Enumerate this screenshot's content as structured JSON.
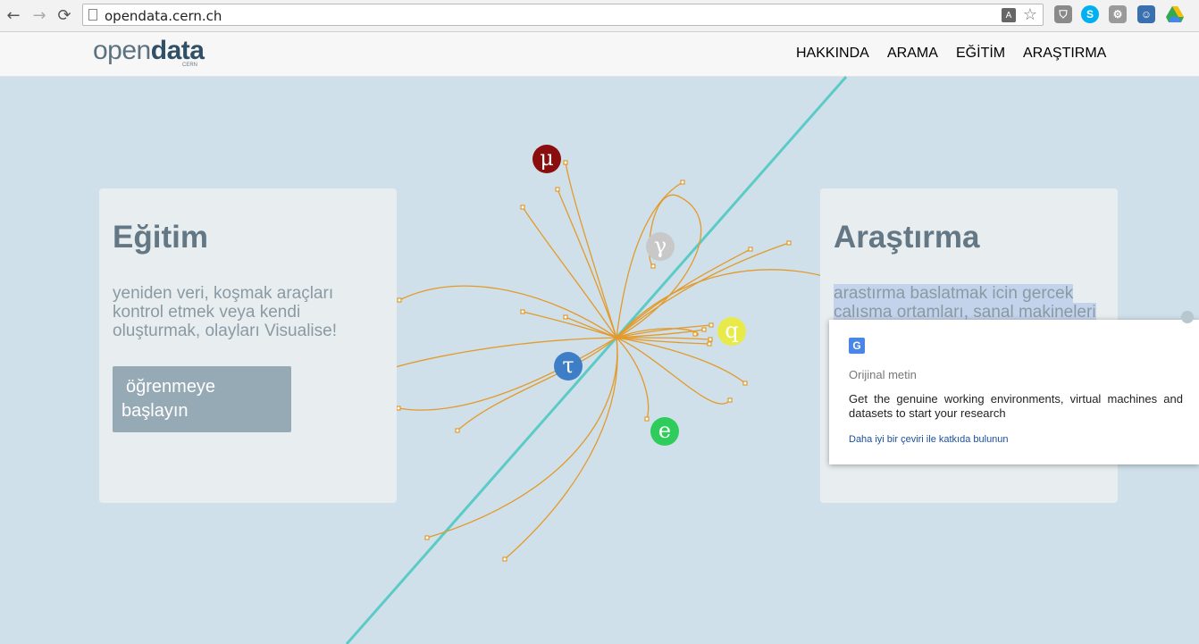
{
  "browser": {
    "url": "opendata.cern.ch",
    "back_icon": "←",
    "forward_icon": "→",
    "reload_icon": "⟳",
    "star_icon": "☆"
  },
  "site": {
    "logo_light": "open",
    "logo_bold": "data",
    "logo_sub": "CERN",
    "menu": [
      "HAKKINDA",
      "ARAMA",
      "EĞİTİM",
      "ARAŞTIRMA"
    ]
  },
  "education": {
    "title": "Eğitim",
    "lines": [
      "yeniden veri, koşmak araçları",
      "kontrol etmek veya kendi",
      "oluşturmak, olayları Visualise!"
    ],
    "button_line1": "öğrenmeye",
    "button_line2": "başlayın"
  },
  "research": {
    "title": "Araştırma",
    "line1": "arastırma baslatmak icin gercek",
    "line2": "calısma ortamları, sanal makineleri"
  },
  "particles": [
    {
      "symbol": "μ",
      "color": "#8b0e0e"
    },
    {
      "symbol": "γ",
      "color": "#c8c8c8"
    },
    {
      "symbol": "q",
      "color": "#e8ea4a"
    },
    {
      "symbol": "τ",
      "color": "#3d7ec7"
    },
    {
      "symbol": "e",
      "color": "#2ecc5a"
    }
  ],
  "translate_popup": {
    "title": "Orijinal metin",
    "text": "Get the genuine working environments, virtual machines and datasets to start your research",
    "link": "Daha iyi bir çeviri ile katkıda bulunun"
  }
}
